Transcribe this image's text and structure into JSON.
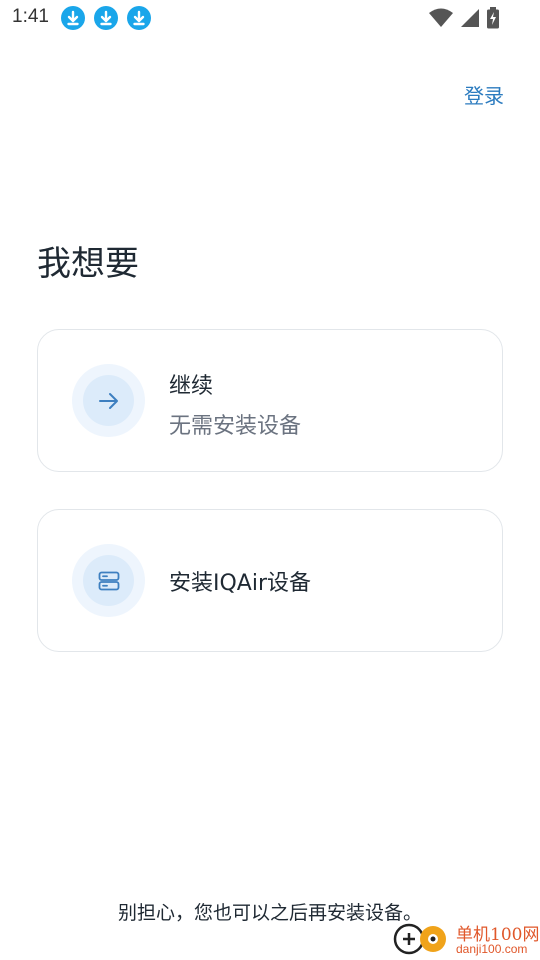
{
  "status_bar": {
    "time": "1:41",
    "notification_icons": [
      "download-icon",
      "download-icon",
      "download-icon"
    ],
    "system_icons": [
      "wifi-icon",
      "signal-icon",
      "battery-charging-icon"
    ]
  },
  "header": {
    "login_label": "登录"
  },
  "main": {
    "heading": "我想要",
    "options": [
      {
        "icon": "arrow-right-icon",
        "title": "继续",
        "subtitle": "无需安装设备"
      },
      {
        "icon": "device-icon",
        "title": "安装IQAir设备"
      }
    ]
  },
  "footer": {
    "note": "别担心，您也可以之后再安装设备。"
  },
  "watermark": {
    "name": "单机100网",
    "domain": "danji100.com"
  },
  "colors": {
    "accent": "#2b7bbf",
    "icon_bg_outer": "#eef5fd",
    "icon_bg_inner": "#dcebfa",
    "card_border": "#e2e6ea",
    "download_badge": "#1aa6ea",
    "watermark": "#e0572a"
  }
}
